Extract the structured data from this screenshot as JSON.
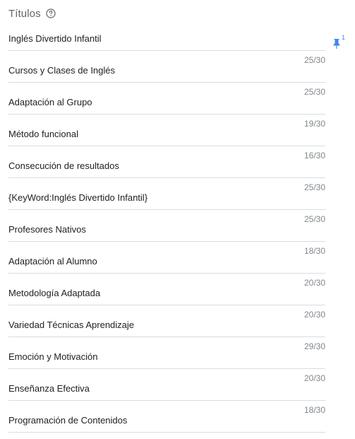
{
  "header": {
    "title": "Títulos",
    "help_icon": "help-circle-icon"
  },
  "pin": {
    "icon": "pin-icon",
    "count": "1",
    "color": "#4285f4"
  },
  "headlines": [
    {
      "text": "Inglés Divertido Infantil",
      "count": "25/30"
    },
    {
      "text": "Cursos y Clases de Inglés",
      "count": "25/30"
    },
    {
      "text": "Adaptación al Grupo",
      "count": "19/30"
    },
    {
      "text": "Método funcional",
      "count": "16/30"
    },
    {
      "text": "Consecución de resultados",
      "count": "25/30"
    },
    {
      "text": "{KeyWord:Inglés Divertido Infantil}",
      "count": "25/30"
    },
    {
      "text": "Profesores Nativos",
      "count": "18/30"
    },
    {
      "text": "Adaptación al Alumno",
      "count": "20/30"
    },
    {
      "text": "Metodología Adaptada",
      "count": "20/30"
    },
    {
      "text": "Variedad Técnicas Aprendizaje",
      "count": "29/30"
    },
    {
      "text": "Emoción y Motivación",
      "count": "20/30"
    },
    {
      "text": "Enseñanza Efectiva",
      "count": "18/30"
    },
    {
      "text": "Programación de Contenidos",
      "count": ""
    }
  ]
}
